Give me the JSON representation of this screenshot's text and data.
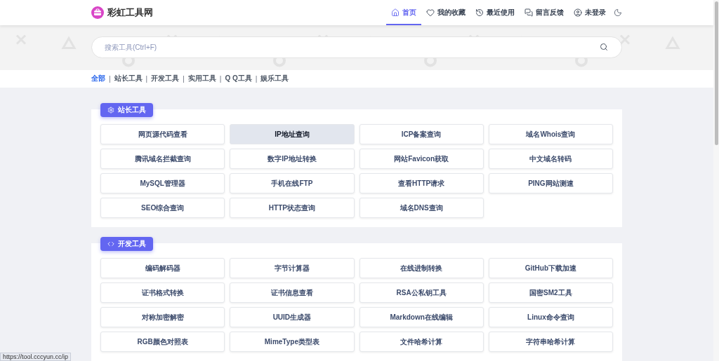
{
  "header": {
    "logo_text": "彩虹工具网",
    "nav": [
      {
        "label": "首页",
        "selected": true
      },
      {
        "label": "我的收藏",
        "selected": false
      },
      {
        "label": "最近使用",
        "selected": false
      },
      {
        "label": "留言反馈",
        "selected": false
      },
      {
        "label": "未登录",
        "selected": false
      }
    ]
  },
  "search": {
    "placeholder": "搜索工具(Ctrl+F)"
  },
  "filter_separator": "|",
  "filters": [
    {
      "label": "全部",
      "selected": true
    },
    {
      "label": "站长工具",
      "selected": false
    },
    {
      "label": "开发工具",
      "selected": false
    },
    {
      "label": "实用工具",
      "selected": false
    },
    {
      "label": "Q Q工具",
      "selected": false
    },
    {
      "label": "娱乐工具",
      "selected": false
    }
  ],
  "sections": [
    {
      "title": "站长工具",
      "tools": [
        {
          "label": "网页源代码查看",
          "selected": false
        },
        {
          "label": "IP地址查询",
          "selected": true
        },
        {
          "label": "ICP备案查询",
          "selected": false
        },
        {
          "label": "域名Whois查询",
          "selected": false
        },
        {
          "label": "腾讯域名拦截查询",
          "selected": false
        },
        {
          "label": "数字IP地址转换",
          "selected": false
        },
        {
          "label": "网站Favicon获取",
          "selected": false
        },
        {
          "label": "中文域名转码",
          "selected": false
        },
        {
          "label": "MySQL管理器",
          "selected": false
        },
        {
          "label": "手机在线FTP",
          "selected": false
        },
        {
          "label": "查看HTTP请求",
          "selected": false
        },
        {
          "label": "PING网站测速",
          "selected": false
        },
        {
          "label": "SEO综合查询",
          "selected": false
        },
        {
          "label": "HTTP状态查询",
          "selected": false
        },
        {
          "label": "域名DNS查询",
          "selected": false
        }
      ]
    },
    {
      "title": "开发工具",
      "tools": [
        {
          "label": "编码解码器",
          "selected": false
        },
        {
          "label": "字节计算器",
          "selected": false
        },
        {
          "label": "在线进制转换",
          "selected": false
        },
        {
          "label": "GitHub下载加速",
          "selected": false
        },
        {
          "label": "证书格式转换",
          "selected": false
        },
        {
          "label": "证书信息查看",
          "selected": false
        },
        {
          "label": "RSA公私钥工具",
          "selected": false
        },
        {
          "label": "国密SM2工具",
          "selected": false
        },
        {
          "label": "对称加密解密",
          "selected": false
        },
        {
          "label": "UUID生成器",
          "selected": false
        },
        {
          "label": "Markdown在线编辑",
          "selected": false
        },
        {
          "label": "Linux命令查询",
          "selected": false
        },
        {
          "label": "RGB颜色对照表",
          "selected": false
        },
        {
          "label": "MimeType类型表",
          "selected": false
        },
        {
          "label": "文件哈希计算",
          "selected": false
        },
        {
          "label": "字符串哈希计算",
          "selected": false
        }
      ]
    }
  ],
  "status_bar": {
    "url": "https://tool.cccyun.cc/ip"
  }
}
